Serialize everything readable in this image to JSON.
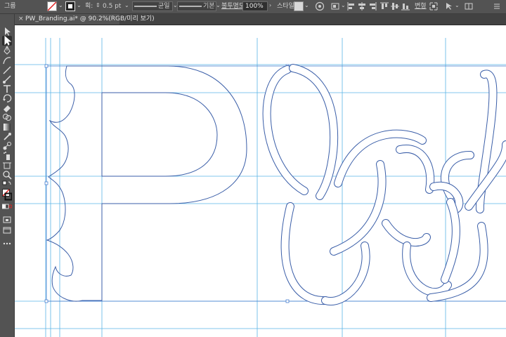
{
  "control_bar": {
    "group_label": "그룹",
    "stroke_label": "획:",
    "stroke_weight": "0.5 pt",
    "brush_label": "균일",
    "profile_label": "기본",
    "opacity_label": "불투명도:",
    "opacity_value": "100%",
    "style_label": "스타일:",
    "transform_label": "변형"
  },
  "document_tab": {
    "close": "×",
    "title": "PW_Branding.ai* @ 90.2%(RGB/미리 보기)"
  },
  "tools": [
    "selection-tool",
    "direct-selection-tool",
    "pen-tool",
    "curvature-tool",
    "line-tool",
    "paintbrush-tool",
    "type-tool",
    "rotate-tool",
    "eraser-tool",
    "shape-builder-tool",
    "gradient-tool",
    "eyedropper-tool",
    "blend-tool",
    "symbol-sprayer-tool",
    "artboard-tool",
    "slice-tool",
    "zoom-tool",
    "swap-colors",
    "fill-stroke-swatch",
    "default-colors",
    "color-mode",
    "screen-mode",
    "more-tools"
  ],
  "colors": {
    "guide": "#5ab4e6",
    "outline": "#3a5ea8",
    "canvas": "#ffffff",
    "ui": "#535353"
  }
}
